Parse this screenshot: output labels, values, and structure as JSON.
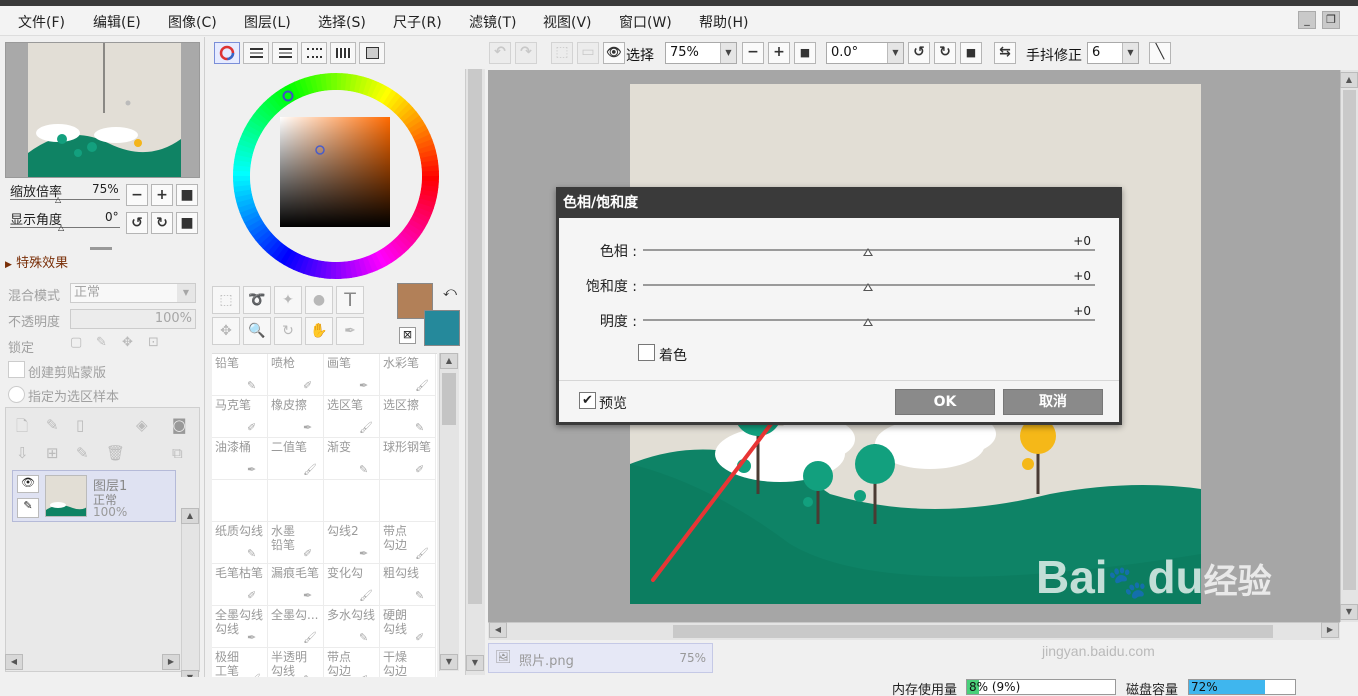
{
  "menu": {
    "items": [
      "文件(F)",
      "编辑(E)",
      "图像(C)",
      "图层(L)",
      "选择(S)",
      "尺子(R)",
      "滤镜(T)",
      "视图(V)",
      "窗口(W)",
      "帮助(H)"
    ],
    "win_min": "_",
    "win_restore": "❐"
  },
  "navigator": {
    "zoom_label": "缩放倍率",
    "zoom_value": "75%",
    "angle_label": "显示角度",
    "angle_value": "0°"
  },
  "effects": {
    "section_label": "特殊效果",
    "blend_label": "混合模式",
    "blend_value": "正常",
    "opacity_label": "不透明度",
    "opacity_value": "100%",
    "lock_label": "锁定",
    "clip_label": "创建剪贴蒙版",
    "select_source_label": "指定为选区样本"
  },
  "layer": {
    "name": "图层1",
    "mode": "正常",
    "opacity": "100%"
  },
  "brushes": [
    [
      "铅笔",
      "喷枪",
      "画笔",
      "水彩笔"
    ],
    [
      "马克笔",
      "橡皮擦",
      "选区笔",
      "选区擦"
    ],
    [
      "油漆桶",
      "二值笔",
      "渐变",
      "球形钢笔"
    ],
    [
      "",
      "",
      "",
      ""
    ],
    [
      "纸质勾线",
      "水墨\n铅笔",
      "勾线2",
      "带点\n勾边"
    ],
    [
      "毛笔枯笔",
      "漏痕毛笔",
      "变化勾",
      "粗勾线"
    ],
    [
      "全墨勾线\n勾线",
      "全墨勾...",
      "多水勾线",
      "硬朗\n勾线"
    ],
    [
      "极细\n工笔",
      "半透明\n勾线",
      "带点\n勾边",
      "干燥\n勾边"
    ]
  ],
  "colors": {
    "primary": "#b28058",
    "secondary": "#25899b",
    "accent_dialog": "#3a3a3a"
  },
  "toolbar": {
    "select_label": "选择",
    "zoom_value": "75%",
    "angle_value": "0.0°",
    "stabilizer_label": "手抖修正",
    "stabilizer_value": "6"
  },
  "dialog": {
    "title": "色相/饱和度",
    "hue_label": "色相 :",
    "hue_value": "+0",
    "sat_label": "饱和度 :",
    "sat_value": "+0",
    "light_label": "明度 :",
    "light_value": "+0",
    "colorize_label": "着色",
    "colorize_checked": false,
    "preview_label": "预览",
    "preview_checked": true,
    "preview_check_glyph": "✔",
    "ok_label": "OK",
    "cancel_label": "取消"
  },
  "file_tab": {
    "name": "照片.png",
    "zoom": "75%"
  },
  "status": {
    "memory_label": "内存使用量",
    "memory_value": "8% (9%)",
    "memory_fraction": 0.08,
    "disk_label": "磁盘容量",
    "disk_value": "72%",
    "disk_fraction": 0.72
  },
  "watermark": {
    "brand": "Bai",
    "brand2": "du",
    "cn": "经验",
    "url": "jingyan.baidu.com"
  }
}
